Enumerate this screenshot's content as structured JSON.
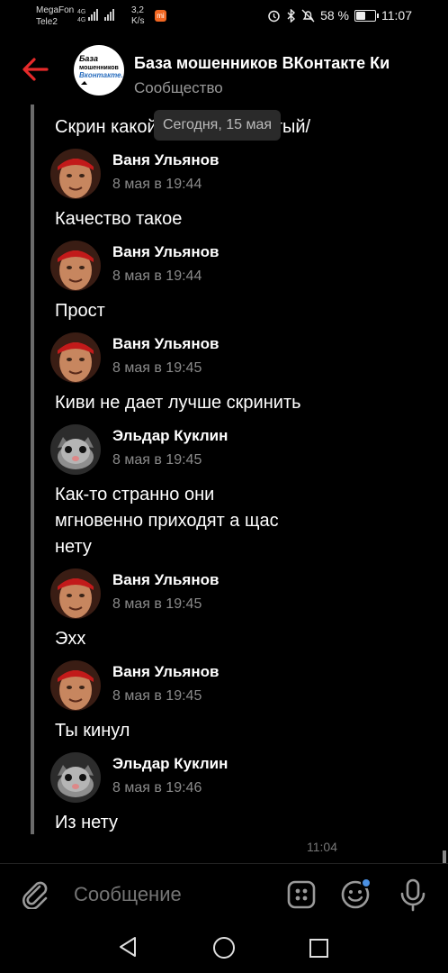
{
  "status_bar": {
    "carrier1": "MegaFon",
    "carrier2": "Tele2",
    "net1": "4G",
    "net2": "4G",
    "speed_value": "3,2",
    "speed_unit": "K/s",
    "battery_percent": "58 %",
    "battery_level": 0.58,
    "clock": "11:07"
  },
  "header": {
    "title": "База мошенников ВКонтакте  Ки",
    "subtitle": "Сообщество",
    "logo_line1": "База",
    "logo_line2": "мошенников",
    "logo_line3": "Вконтакте."
  },
  "date_chip": "Сегодня, 15 мая",
  "messages": [
    {
      "text": "Скрин какой-то перевернутый/"
    },
    {
      "author": "Ваня Ульянов",
      "time": "8 мая в 19:44",
      "lines": [
        "Качество такое"
      ]
    },
    {
      "author": "Ваня Ульянов",
      "time": "8 мая в 19:44",
      "lines": [
        "Прост"
      ]
    },
    {
      "author": "Ваня Ульянов",
      "time": "8 мая в 19:45",
      "lines": [
        "Киви не дает лучше скринить"
      ]
    },
    {
      "author": "Эльдар Куклин",
      "time": "8 мая в 19:45",
      "lines": [
        "Как-то странно они",
        "мгновенно приходят а щас",
        "нету"
      ]
    },
    {
      "author": "Ваня Ульянов",
      "time": "8 мая в 19:45",
      "lines": [
        "Эхх"
      ]
    },
    {
      "author": "Ваня Ульянов",
      "time": "8 мая в 19:45",
      "lines": [
        "Ты кинул"
      ]
    },
    {
      "author": "Эльдар Куклин",
      "time": "8 мая в 19:46",
      "lines": [
        "Из нету"
      ]
    }
  ],
  "message_time": "11:04",
  "composer": {
    "placeholder": "Сообщение"
  },
  "colors": {
    "accent_red": "#e52a2a",
    "background": "#000000",
    "muted": "#8a8a8a"
  }
}
